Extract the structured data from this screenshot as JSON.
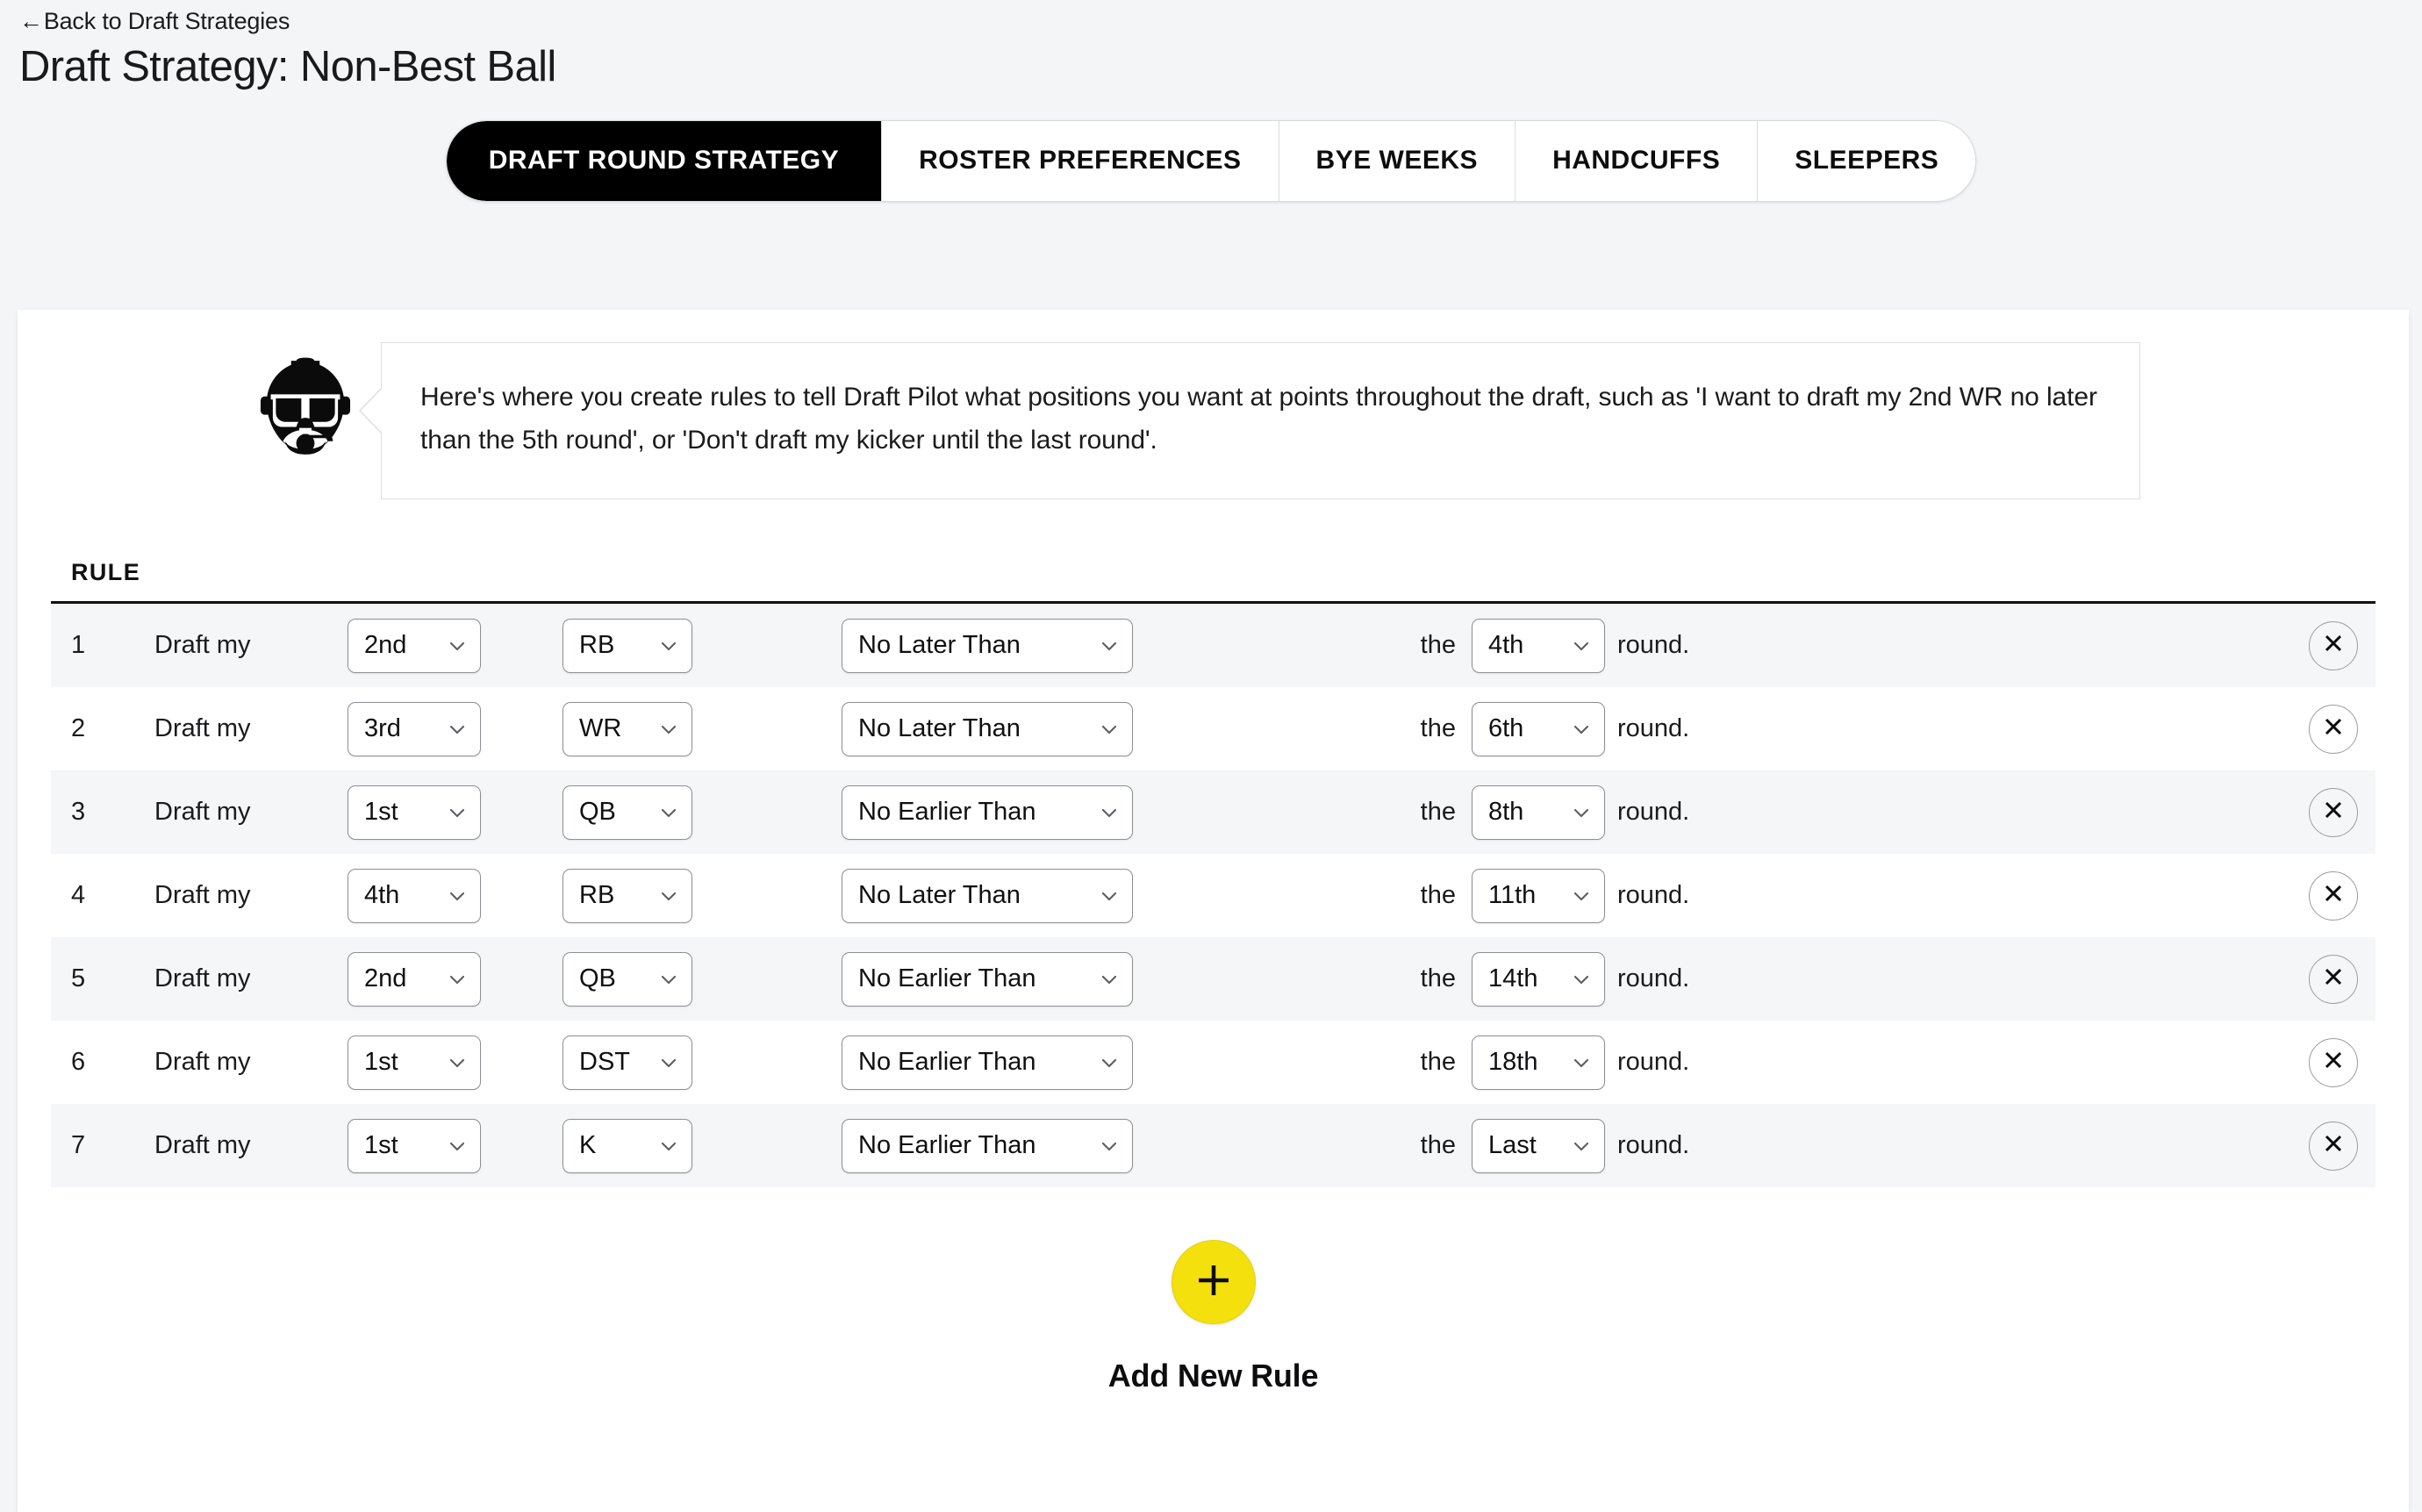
{
  "header": {
    "back_arrow": "←",
    "back_label": "Back to Draft Strategies",
    "title": "Draft Strategy: Non-Best Ball"
  },
  "tabs": [
    {
      "label": "DRAFT ROUND STRATEGY",
      "active": true
    },
    {
      "label": "ROSTER PREFERENCES",
      "active": false
    },
    {
      "label": "BYE WEEKS",
      "active": false
    },
    {
      "label": "HANDCUFFS",
      "active": false
    },
    {
      "label": "SLEEPERS",
      "active": false
    }
  ],
  "banner": {
    "icon": "pilot-helmet-icon",
    "text": "Here's where you create rules to tell Draft Pilot what positions you want at points throughout the draft, such as 'I want to draft my 2nd WR no later than the 5th round', or 'Don't draft my kicker until the last round'."
  },
  "table": {
    "header": "RULE",
    "lead_text": "Draft my",
    "the_text": "the",
    "round_text": "round.",
    "rows": [
      {
        "num": "1",
        "lead": "Draft my",
        "ordinal": "2nd",
        "position": "RB",
        "timing": "No Later Than",
        "the": "the",
        "round": "4th",
        "round_text": "round."
      },
      {
        "num": "2",
        "lead": "Draft my",
        "ordinal": "3rd",
        "position": "WR",
        "timing": "No Later Than",
        "the": "the",
        "round": "6th",
        "round_text": "round."
      },
      {
        "num": "3",
        "lead": "Draft my",
        "ordinal": "1st",
        "position": "QB",
        "timing": "No Earlier Than",
        "the": "the",
        "round": "8th",
        "round_text": "round."
      },
      {
        "num": "4",
        "lead": "Draft my",
        "ordinal": "4th",
        "position": "RB",
        "timing": "No Later Than",
        "the": "the",
        "round": "11th",
        "round_text": "round."
      },
      {
        "num": "5",
        "lead": "Draft my",
        "ordinal": "2nd",
        "position": "QB",
        "timing": "No Earlier Than",
        "the": "the",
        "round": "14th",
        "round_text": "round."
      },
      {
        "num": "6",
        "lead": "Draft my",
        "ordinal": "1st",
        "position": "DST",
        "timing": "No Earlier Than",
        "the": "the",
        "round": "18th",
        "round_text": "round."
      },
      {
        "num": "7",
        "lead": "Draft my",
        "ordinal": "1st",
        "position": "K",
        "timing": "No Earlier Than",
        "the": "the",
        "round": "Last",
        "round_text": "round."
      }
    ]
  },
  "add_rule": {
    "icon": "plus-icon",
    "label": "Add New Rule"
  },
  "colors": {
    "accent_yellow": "#F3E00D",
    "active_tab_bg": "#000000",
    "page_bg": "#F4F5F7",
    "row_alt_bg": "#F4F6F8"
  }
}
